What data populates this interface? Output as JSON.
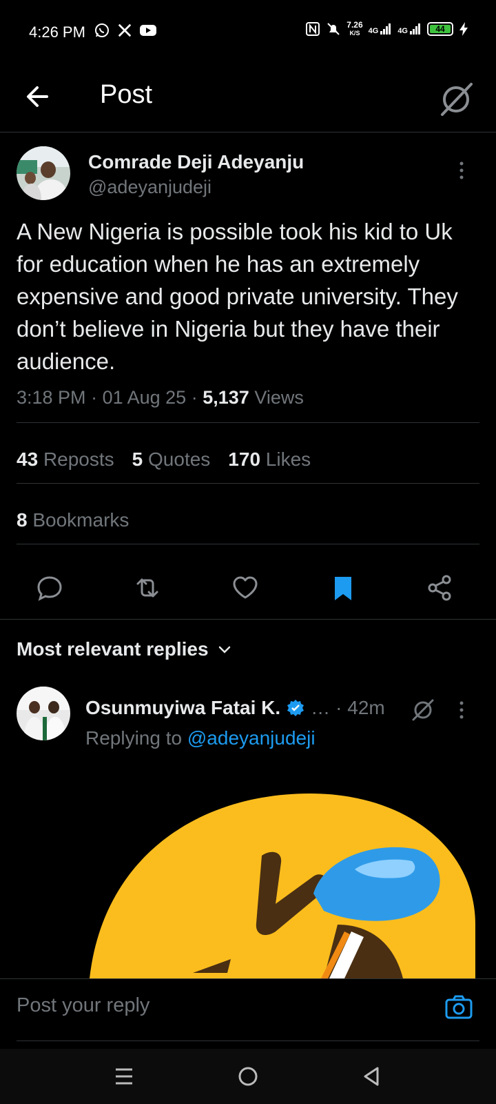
{
  "status_bar": {
    "time": "4:26 PM",
    "left_icons": [
      "whatsapp-icon",
      "x-icon",
      "youtube-icon"
    ],
    "network_speed_value": "7.26",
    "network_speed_unit": "K/S",
    "signal_1": "4G",
    "signal_2": "4G",
    "battery": "44"
  },
  "header": {
    "title": "Post"
  },
  "post": {
    "author_name": "Comrade Deji Adeyanju",
    "author_handle": "@adeyanjudeji",
    "text": "A New Nigeria is possible took his kid to Uk for education when he has an extremely expensive and good private university. They don’t believe in Nigeria but they have their audience.",
    "time": "3:18 PM",
    "date": "01 Aug 25",
    "views_count": "5,137",
    "views_label": "Views",
    "reposts_count": "43",
    "reposts_label": "Reposts",
    "quotes_count": "5",
    "quotes_label": "Quotes",
    "likes_count": "170",
    "likes_label": "Likes",
    "bookmarks_count": "8",
    "bookmarks_label": "Bookmarks"
  },
  "replies": {
    "heading": "Most relevant replies",
    "items": [
      {
        "author_name": "Osunmuyiwa Fatai K.",
        "verified": true,
        "ellipsis": "…",
        "time": "· 42m",
        "replying_prefix": "Replying to",
        "replying_to": "@adeyanjudeji"
      }
    ]
  },
  "composer": {
    "placeholder": "Post your reply"
  },
  "colors": {
    "accent": "#1d9bf0",
    "text_primary": "#e7e9ea",
    "text_secondary": "#71767b",
    "divider": "#2f3336",
    "emoji_yellow": "#fbbd1d",
    "emoji_tear": "#2f9be8"
  }
}
